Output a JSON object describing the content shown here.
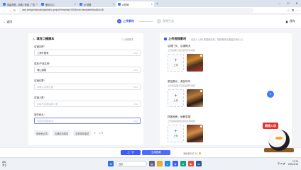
{
  "browser": {
    "tabs": [
      {
        "label": "创建商品 - 剪映 | 商品, 广告",
        "active": false
      },
      {
        "label": "团队中心",
        "active": false
      },
      {
        "label": "AI 视频",
        "active": true
      },
      {
        "label": "AI视频",
        "active": false
      }
    ],
    "new_tab": "+",
    "url": "cam.webpointstudio/aiadvideo-project?template=500&from=templateDetail&id=80",
    "window_controls": [
      "—",
      "☐",
      "✕"
    ]
  },
  "header": {
    "back_label": "返回",
    "steps": [
      {
        "num": "1",
        "label": "上传素材",
        "active": true
      },
      {
        "num": "2",
        "label": "视频生成",
        "active": false
      }
    ],
    "save_label": "保存"
  },
  "left_card": {
    "title": "填写口播脚本",
    "hint": "示例脚本",
    "fields": [
      {
        "label": "店铺名称",
        "required": true,
        "value": "上海外婆家",
        "is_value": true,
        "count": "0/40"
      },
      {
        "label": "菜品/产品名称",
        "required": true,
        "value": "海山酒楼",
        "is_value": true,
        "count": "0/40"
      },
      {
        "label": "店铺位置",
        "required": true,
        "value": "请输入店铺位置",
        "is_value": false,
        "count": "0/40"
      },
      {
        "label": "店铺人数",
        "required": true,
        "value": "请填写店铺容纳人数",
        "is_value": false,
        "count": "0/40"
      },
      {
        "label": "宣传卖点",
        "required": true,
        "value": "请描述店铺卖点",
        "is_value": false,
        "count": "0/40"
      },
      {
        "label": "营销活动",
        "required": false,
        "value": "请描述营销活动",
        "is_value": false,
        "count": "0/40"
      }
    ],
    "chips": [
      "营销卖点词",
      "店铺活动描述",
      "店家特色描述"
    ],
    "page_indicator": "1 / 3"
  },
  "right_card": {
    "title": "上传视频素材",
    "subtitle": "请至少上传1段视频素材，视频每段长度建议5秒以上",
    "groups": [
      {
        "title": "店铺门头、店铺概况",
        "desc": "上传店铺门头及店内环境视频",
        "upload_label": "上传"
      },
      {
        "title": "菜品展示、菜品特写",
        "desc": "上传菜品展示及菜品细节视频",
        "upload_label": "上传"
      },
      {
        "title": "顾客就餐、就餐氛围",
        "desc": "上传顾客用餐及店内氛围视频",
        "upload_label": "上传"
      }
    ]
  },
  "bottom": {
    "prev_label": "上一步",
    "generate_label": "生成视频",
    "points_text": "消耗积分约 15"
  },
  "sticker": {
    "label": "跟随入场"
  },
  "taskbar": {
    "weather_temp": "4°C",
    "weather_desc": "多云",
    "search_placeholder": "搜索",
    "tray": "中 ⊕ 🔊",
    "time": "17:24",
    "date": "2024/1/16"
  }
}
